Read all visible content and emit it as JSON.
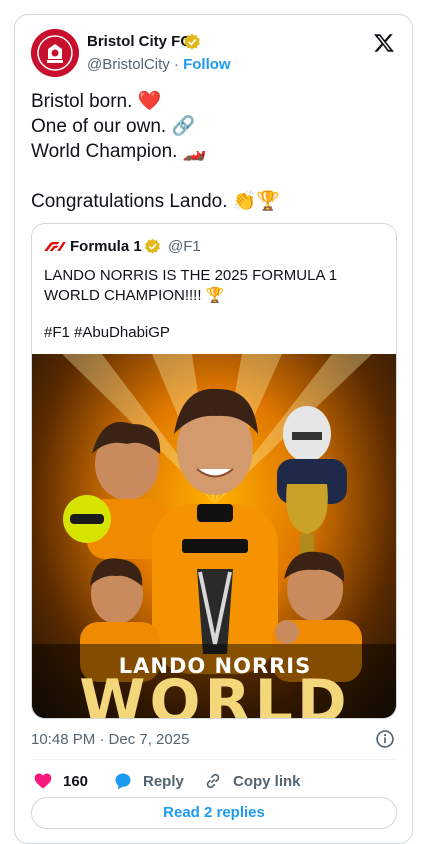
{
  "author": {
    "name": "Bristol City FC",
    "handle": "@BristolCity",
    "separator": "·",
    "follow_label": "Follow"
  },
  "post": {
    "lines": [
      "Bristol born. ❤️",
      "One of our own. 🔗",
      "World Champion. 🏎️",
      "Congratulations Lando. 👏🏆"
    ]
  },
  "quote": {
    "name": "Formula 1",
    "handle": "@F1",
    "text": "LANDO NORRIS IS THE 2025 FORMULA 1 WORLD CHAMPION!!!! 🏆",
    "hashtags": "#F1 #AbuDhabiGP",
    "image": {
      "banner_name": "LANDO NORRIS",
      "banner_world": "WORLD"
    }
  },
  "meta": {
    "timestamp": "10:48 PM · Dec 7, 2025"
  },
  "actions": {
    "like_count": "160",
    "reply_label": "Reply",
    "copy_label": "Copy link",
    "read_replies_label": "Read 2 replies"
  },
  "colors": {
    "accent": "#1d9bf0",
    "like": "#f91880",
    "text_secondary": "#536471",
    "border": "#cfd9de",
    "f1_red": "#e10600",
    "club_red": "#c8102e"
  },
  "icons": {
    "avatar": "bristol-city-crest",
    "verified": "verified-gold-badge-icon",
    "platform": "x-logo-icon",
    "info": "info-icon",
    "like": "heart-icon",
    "reply": "speech-bubble-icon",
    "copy": "link-icon"
  }
}
